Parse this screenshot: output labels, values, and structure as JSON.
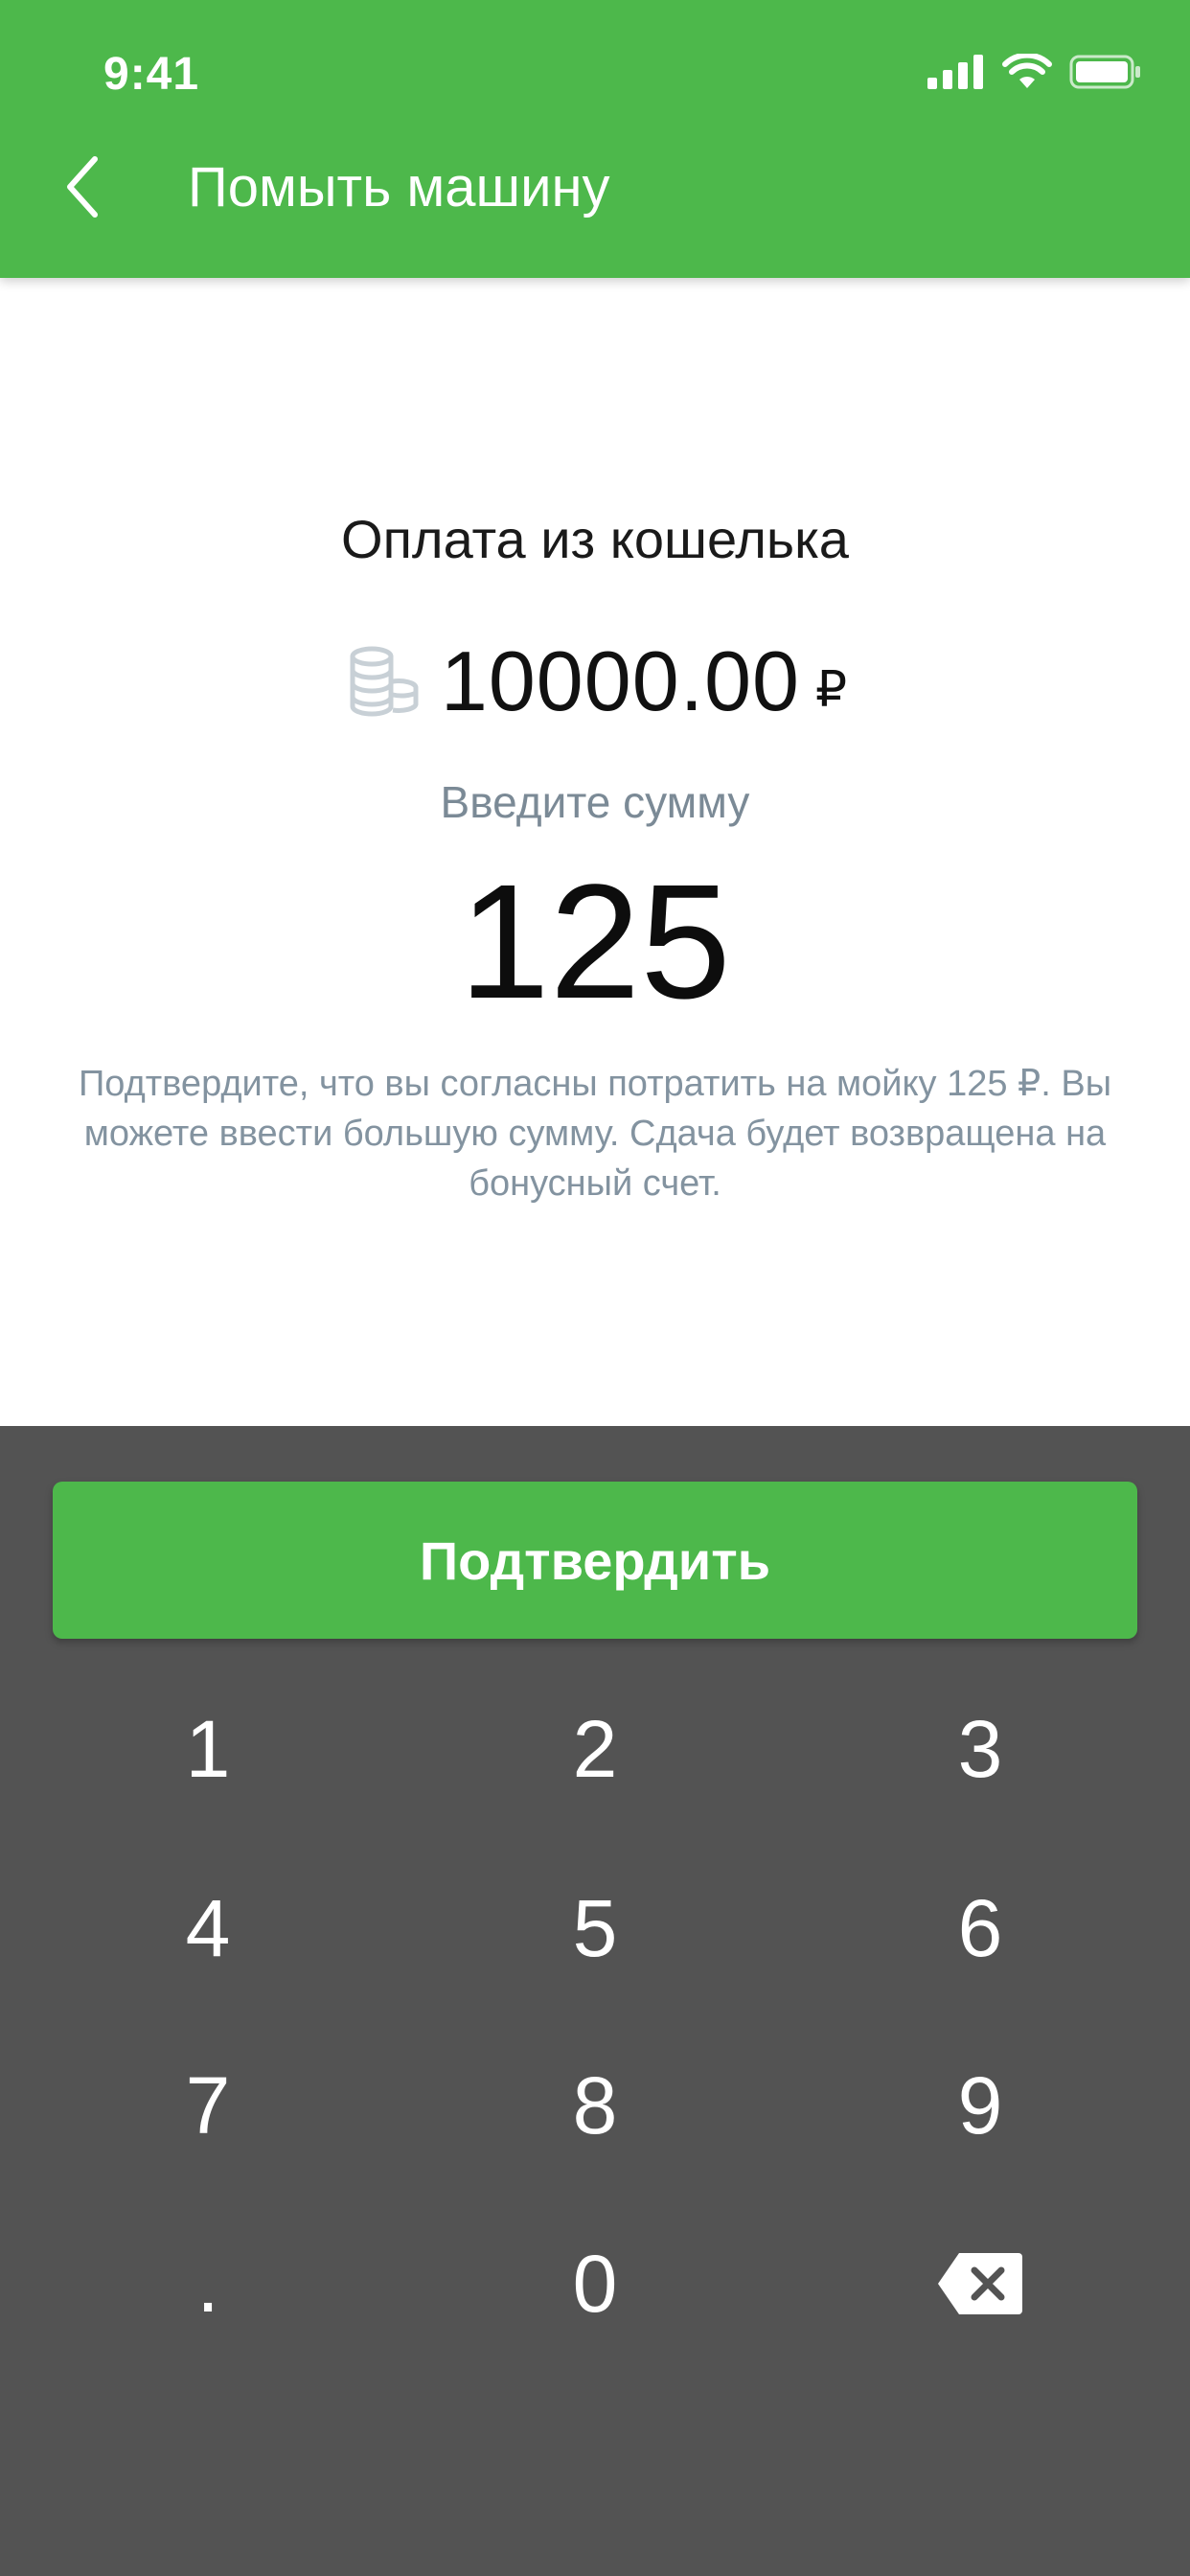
{
  "status_bar": {
    "time": "9:41",
    "icons": [
      "signal-icon",
      "wifi-icon",
      "battery-icon"
    ]
  },
  "header": {
    "back_icon": "chevron-left-icon",
    "title": "Помыть машину",
    "color": "#4db84b"
  },
  "wallet": {
    "title": "Оплата из кошелька",
    "icon": "coins-icon",
    "balance": "10000.00",
    "currency": "₽"
  },
  "amount": {
    "label": "Введите сумму",
    "value": "125"
  },
  "hint": "Подтвердите, что вы согласны потратить на мойку 125 ₽. Вы можете ввести большую сумму. Сдача будет возвращена на бонусный счет.",
  "keypad": {
    "confirm_label": "Подтвердить",
    "keys": [
      "1",
      "2",
      "3",
      "4",
      "5",
      "6",
      "7",
      "8",
      "9",
      ".",
      "0"
    ],
    "backspace_icon": "backspace-icon",
    "background": "#535353"
  }
}
